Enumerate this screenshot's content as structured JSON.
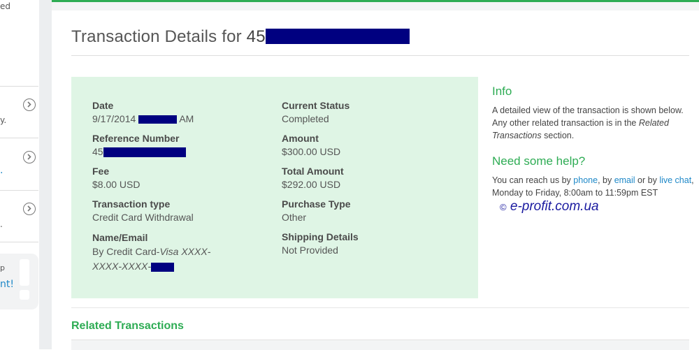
{
  "sidebar": {
    "items": [
      {
        "text": "ed"
      },
      {
        "text": "y."
      },
      {
        "text": "."
      },
      {
        "text": "."
      }
    ],
    "widget": {
      "line1": "p",
      "link": "nt!"
    }
  },
  "header": {
    "title_prefix": "Transaction Details for ",
    "title_id": "45"
  },
  "details": {
    "date": {
      "label": "Date",
      "value_prefix": "9/17/2014",
      "value_suffix": "AM"
    },
    "current_status": {
      "label": "Current Status",
      "value": "Completed"
    },
    "reference_number": {
      "label": "Reference Number",
      "value_prefix": "45"
    },
    "amount": {
      "label": "Amount",
      "value": "$300.00 USD"
    },
    "fee": {
      "label": "Fee",
      "value": "$8.00 USD"
    },
    "total_amount": {
      "label": "Total Amount",
      "value": "$292.00 USD"
    },
    "transaction_type": {
      "label": "Transaction type",
      "value": "Credit Card Withdrawal"
    },
    "purchase_type": {
      "label": "Purchase Type",
      "value": "Other"
    },
    "name_email": {
      "label": "Name/Email",
      "value_prefix": "By Credit Card-",
      "value_italic": "Visa XXXX-XXXX-XXXX-"
    },
    "shipping_details": {
      "label": "Shipping Details",
      "value": "Not Provided"
    }
  },
  "info": {
    "heading": "Info",
    "text_1": "A detailed view of the transaction is shown below. Any other related transaction is in the ",
    "text_italic": "Related Transactions",
    "text_2": " section.",
    "help_heading": "Need some help?",
    "help_1": "You can reach us by ",
    "phone_link": "phone",
    "help_2": ", by ",
    "email_link": "email",
    "help_3": " or by ",
    "chat_link": "live chat",
    "help_4": ", Monday to Friday, 8:00am to 11:59pm EST"
  },
  "watermark": "e-profit.com.ua",
  "related": {
    "title": "Related Transactions"
  },
  "colors": {
    "accent": "#2eac54",
    "card_bg": "#dff5e5",
    "link": "#1e88c8",
    "redaction": "#000080"
  }
}
